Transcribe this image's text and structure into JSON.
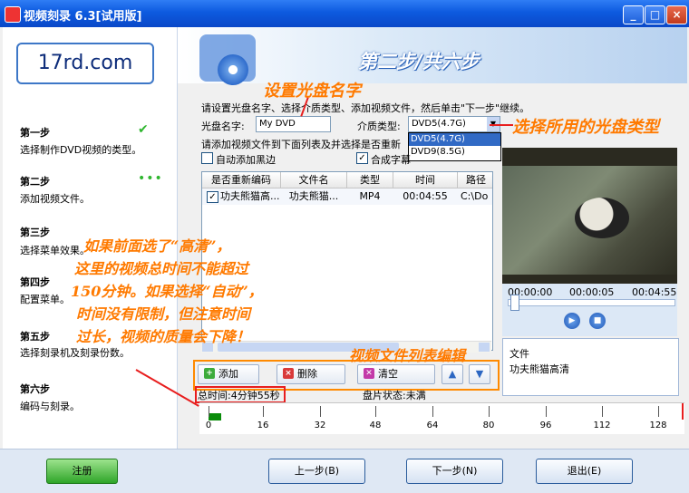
{
  "window": {
    "title": "视频刻录 6.3[试用版]",
    "min": "_",
    "max": "□",
    "close": "×"
  },
  "logo": "17rd.com",
  "banner": {
    "step": "第二步/共六步"
  },
  "steps": [
    {
      "title": "第一步",
      "desc": "选择制作DVD视频的类型。"
    },
    {
      "title": "第二步",
      "desc": "添加视频文件。"
    },
    {
      "title": "第三步",
      "desc": "选择菜单效果。"
    },
    {
      "title": "第四步",
      "desc": "配置菜单。"
    },
    {
      "title": "第五步",
      "desc": "选择刻录机及刻录份数。"
    },
    {
      "title": "第六步",
      "desc": "编码与刻录。"
    }
  ],
  "instructions": "请设置光盘名字、选择介质类型、添加视频文件，然后单击\"下一步\"继续。",
  "disc_name_label": "光盘名字:",
  "disc_name_value": "My DVD",
  "media_type_label": "介质类型:",
  "media_type_value": "DVD5(4.7G)",
  "media_options": [
    "DVD5(4.7G)",
    "DVD9(8.5G)"
  ],
  "add_video_hint": "请添加视频文件到下面列表及并选择是否重新",
  "auto_black_border": "自动添加黑边",
  "merge_subtitle": "合成字幕",
  "table": {
    "headers": [
      "是否重新编码",
      "文件名",
      "类型",
      "时间",
      "路径"
    ],
    "rows": [
      {
        "checked": "✓",
        "name1": "功夫熊猫高...",
        "name2": "功夫熊猫...",
        "type": "MP4",
        "time": "00:04:55",
        "path": "C:\\Do"
      }
    ]
  },
  "buttons": {
    "add": "添加",
    "delete": "删除",
    "clear": "清空",
    "up": "▲",
    "down": "▼"
  },
  "total_time": "总时间:4分钟55秒",
  "disc_status": "盘片状态:未满",
  "timeline_ticks": [
    "0",
    "16",
    "32",
    "48",
    "64",
    "80",
    "96",
    "112",
    "128"
  ],
  "player": {
    "start": "00:00:00",
    "current": "00:00:05",
    "end": "00:04:55",
    "position": 0.017
  },
  "file_info": {
    "label": "文件",
    "name": "功夫熊猫高清"
  },
  "bottom": {
    "register": "注册",
    "prev": "上一步(B)",
    "next": "下一步(N)",
    "exit": "退出(E)"
  },
  "annotations": {
    "disc_name": "设置光盘名字",
    "media_type": "选择所用的光盘类型",
    "hd_note": [
      "如果前面选了“高清”，",
      "这里的视频总时间不能超过",
      "150分钟。如果选择“自动”，",
      "时间没有限制，但注意时间",
      "过长，视频的质量会下降！"
    ],
    "list_edit": "视频文件列表编辑"
  },
  "colors": {
    "annotation": "#ff7a00",
    "arrow": "#e81e1e",
    "title_bar": "#0d5adf"
  }
}
